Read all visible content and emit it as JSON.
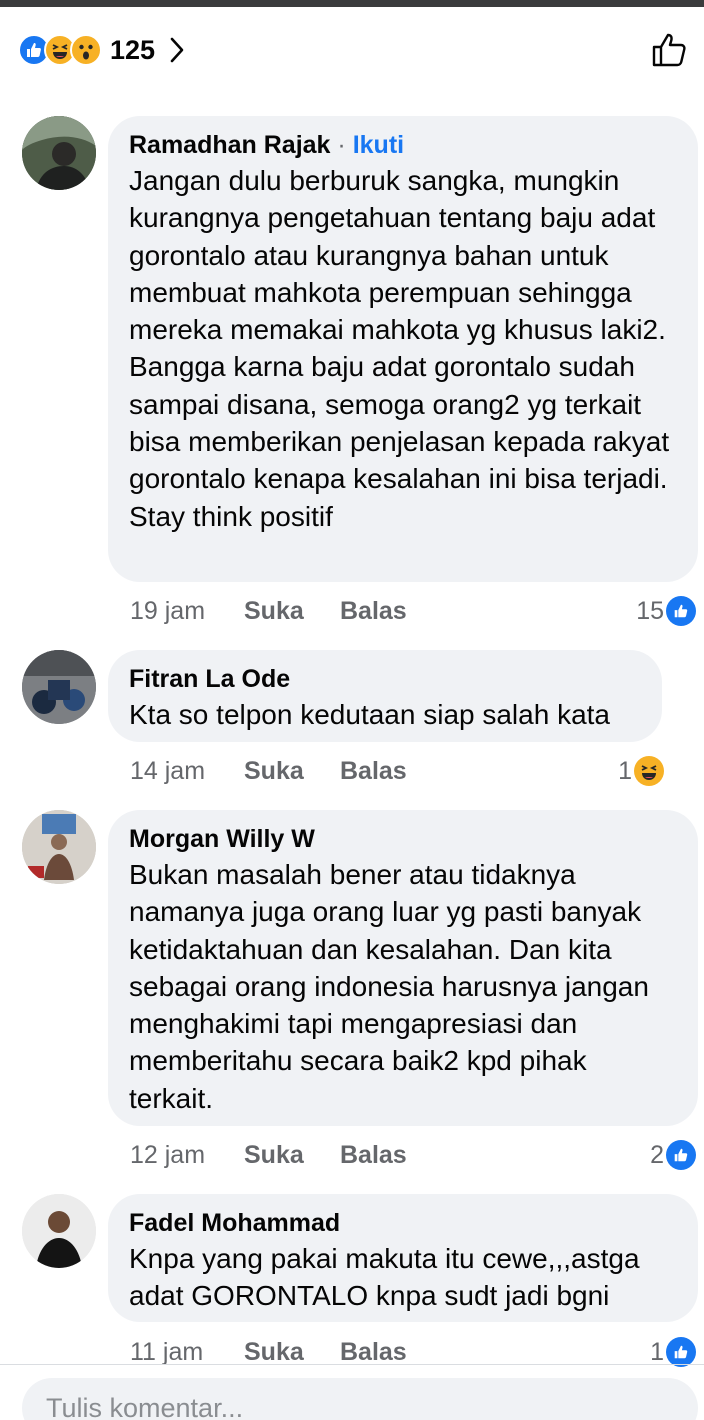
{
  "reactions_summary": {
    "count": "125",
    "icons": [
      "like-icon",
      "haha-icon",
      "wow-icon"
    ],
    "colors": {
      "like": "#1877f2",
      "emoji": "#f7b125"
    }
  },
  "comments": [
    {
      "author": "Ramadhan Rajak",
      "follow_label": "Ikuti",
      "separator": "·",
      "text": "Jangan dulu berburuk sangka, mungkin kurangnya pengetahuan tentang baju adat gorontalo atau kurangnya bahan untuk membuat mahkota perempuan sehingga mereka memakai mahkota yg khusus laki2. Bangga karna baju adat gorontalo sudah sampai disana, semoga orang2 yg terkait bisa memberikan penjelasan kepada rakyat gorontalo kenapa kesalahan ini bisa terjadi. Stay think positif",
      "time": "19 jam",
      "like_label": "Suka",
      "reply_label": "Balas",
      "reaction_count": "15",
      "reaction_icon": "like-icon"
    },
    {
      "author": "Fitran La Ode",
      "text": "Kta so telpon kedutaan siap salah kata",
      "time": "14 jam",
      "like_label": "Suka",
      "reply_label": "Balas",
      "reaction_count": "1",
      "reaction_icon": "haha-icon"
    },
    {
      "author": "Morgan Willy W",
      "text": "Bukan masalah bener atau tidaknya namanya juga orang luar yg pasti banyak ketidaktahuan dan kesalahan. Dan kita sebagai orang indonesia harusnya jangan menghakimi tapi mengapresiasi dan memberitahu secara baik2 kpd pihak terkait.",
      "time": "12 jam",
      "like_label": "Suka",
      "reply_label": "Balas",
      "reaction_count": "2",
      "reaction_icon": "like-icon"
    },
    {
      "author": "Fadel Mohammad",
      "text": "Knpa yang pakai makuta itu cewe,,,astga adat GORONTALO knpa sudt jadi bgni",
      "time": "11 jam",
      "like_label": "Suka",
      "reply_label": "Balas",
      "reaction_count": "1",
      "reaction_icon": "like-icon"
    }
  ],
  "composer": {
    "placeholder": "Tulis komentar..."
  }
}
